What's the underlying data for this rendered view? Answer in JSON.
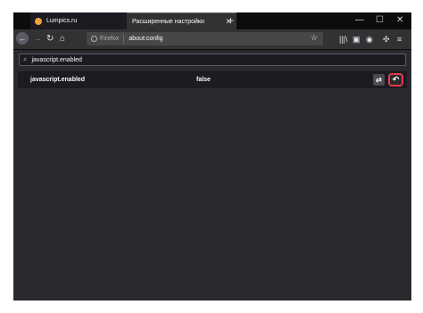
{
  "tabs": [
    {
      "label": "Lumpics.ru",
      "close": "✕"
    },
    {
      "label": "Расширенные настройки",
      "close": "✕"
    }
  ],
  "tabstrip": {
    "new_tab": "+"
  },
  "window_controls": {
    "minimize": "—",
    "maximize": "☐",
    "close": "✕"
  },
  "navbar": {
    "back": "←",
    "forward": "→",
    "reload": "↻",
    "home": "⌂",
    "url_identity": "Firefox",
    "url": "about:config",
    "star": "☆",
    "library": "|||\\",
    "sidebar": "▣",
    "account": "◉",
    "extension": "✣",
    "menu": "≡"
  },
  "search": {
    "value": "javascript.enabled",
    "icon": "⌕"
  },
  "preference": {
    "name": "javascript.enabled",
    "value": "false",
    "toggle_icon": "⇄",
    "reset_icon": "↶"
  },
  "colors": {
    "accent_highlight": "#e3394c",
    "background": "#2a2a2e",
    "tab_favicon": "#f0a13a"
  }
}
